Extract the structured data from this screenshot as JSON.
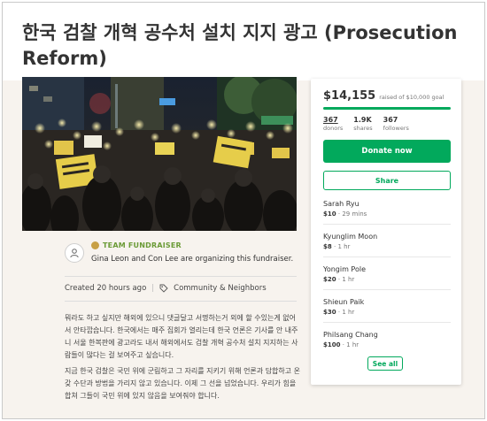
{
  "campaign": {
    "title": "한국 검찰 개혁 공수처 설치 지지 광고 (Prosecution Reform)"
  },
  "organizer": {
    "team_label": "TEAM FUNDRAISER",
    "text": "Gina Leon and Con Lee are organizing this fundraiser."
  },
  "meta": {
    "created": "Created 20 hours ago",
    "category": "Community & Neighbors"
  },
  "story": {
    "paragraph1": "뭐라도 하고 싶지만 해외에 있으니 댓글달고 서명하는거 외에 할 수있는게 없어서 안타깝습니다. 한국에서는 매주 집회가 열리는데 한국 언론은 기사를 안 내주니 서울 한복판에 광고라도 내서 해외에서도 검찰 개혁 공수처 설치 지지하는 사람들이 많다는 걸 보여주고 싶습니다.",
    "paragraph2": "지금 한국 검찰은 국민 위에 군림하고 그 자리를 지키기 위해 언론과 담합하고 온갖 수단과 방법을 가리지 않고 있습니다. 이제 그 선을 넘었습니다. 우리가 힘을 합쳐 그들이 국민 위에 있지 않음을 보여줘야 합니다."
  },
  "sidebar": {
    "raised_amount": "$14,155",
    "raised_goal": "raised of $10,000 goal",
    "progress_percent": 100,
    "stats": [
      {
        "num": "367",
        "label": "donors"
      },
      {
        "num": "1.9K",
        "label": "shares"
      },
      {
        "num": "367",
        "label": "followers"
      }
    ],
    "donate_label": "Donate now",
    "share_label": "Share",
    "donations": [
      {
        "name": "Sarah Ryu",
        "amount": "$10",
        "time": "29 mins"
      },
      {
        "name": "Kyunglim Moon",
        "amount": "$8",
        "time": "1 hr"
      },
      {
        "name": "Yongim Pole",
        "amount": "$20",
        "time": "1 hr"
      },
      {
        "name": "Shieun Paik",
        "amount": "$30",
        "time": "1 hr"
      },
      {
        "name": "Philsang Chang",
        "amount": "$100",
        "time": "1 hr"
      }
    ],
    "see_all_label": "See all"
  },
  "colors": {
    "accent": "#02a95c",
    "team_label": "#6b9b37",
    "background_band": "#f7f3ee"
  },
  "icons": {
    "organizer": "user-icon",
    "category": "tag-icon",
    "team": "team-badge-icon"
  }
}
